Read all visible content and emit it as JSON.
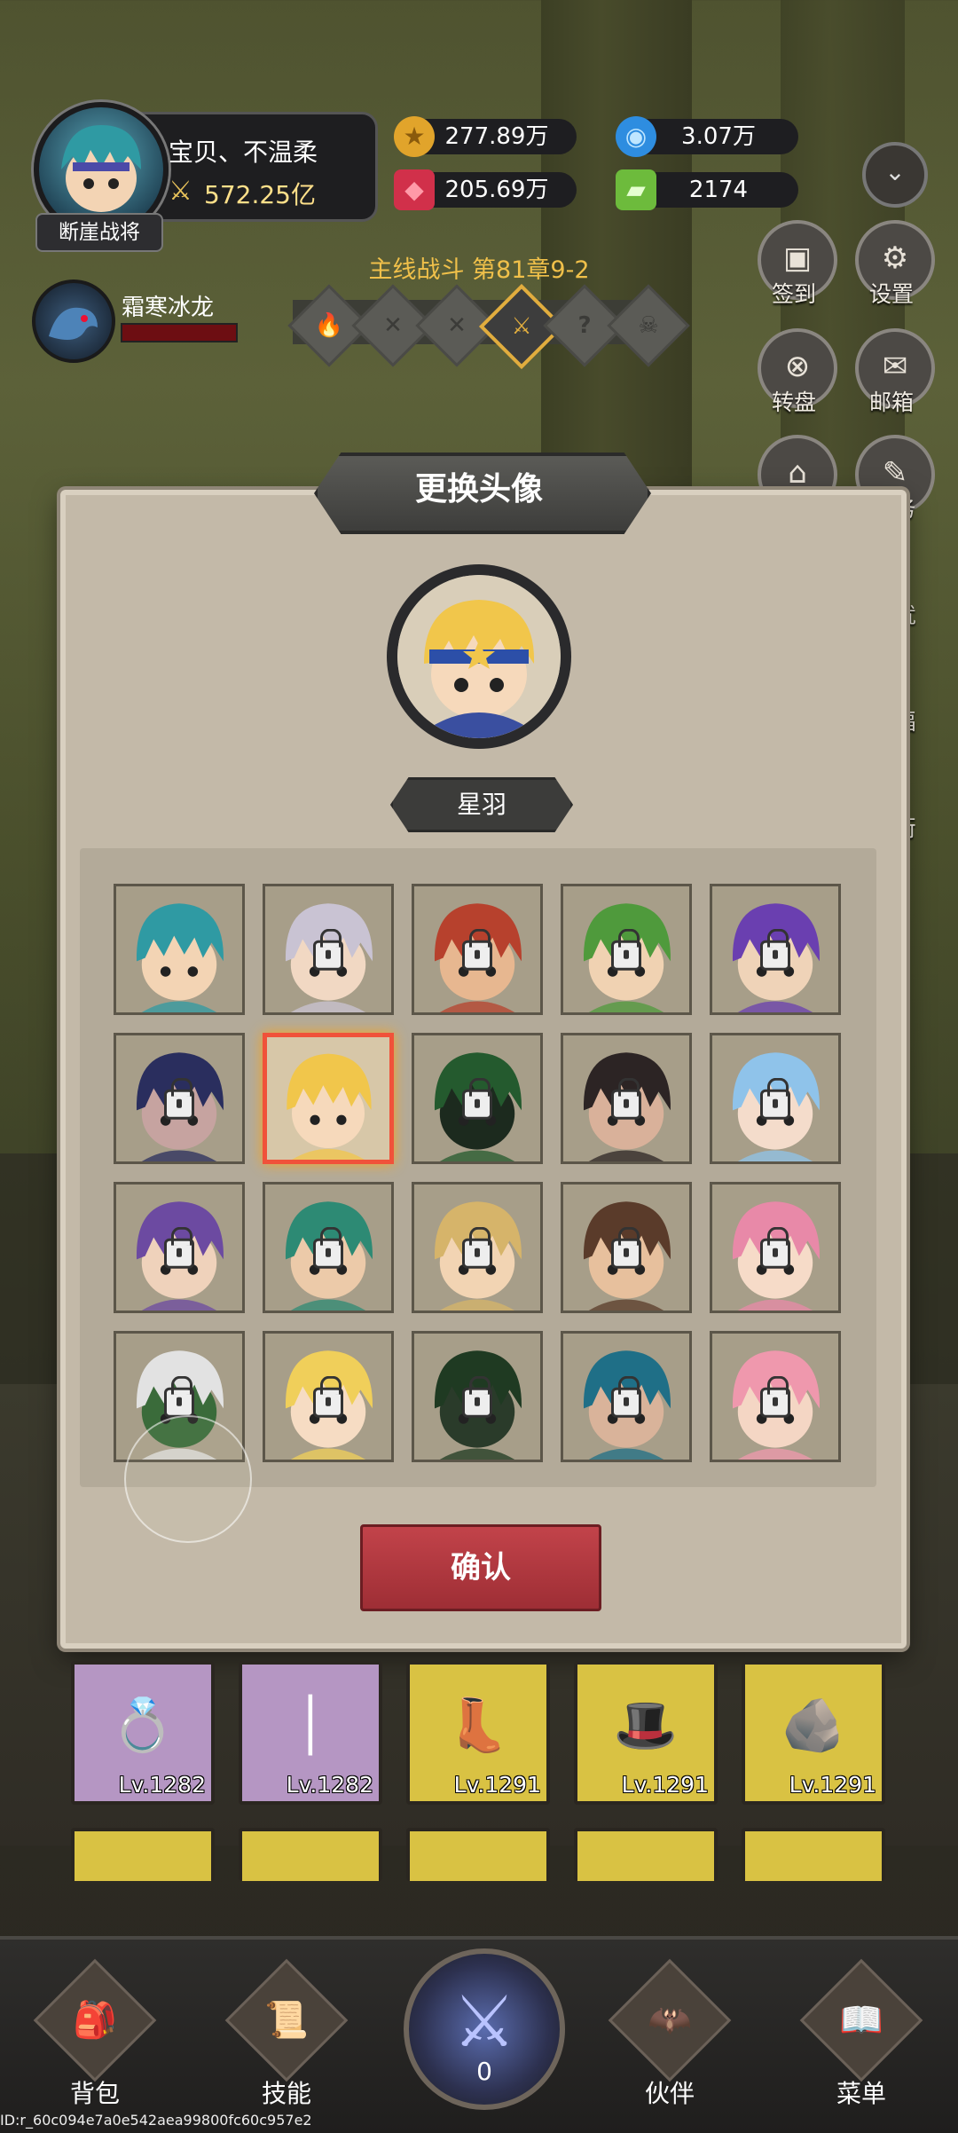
{
  "player": {
    "name": "宝贝、不温柔",
    "power": "572.25亿",
    "title": "断崖战将"
  },
  "resources": [
    {
      "icon": "gold-coin-icon",
      "value": "277.89万",
      "color": "#e1a42b"
    },
    {
      "icon": "blue-orb-icon",
      "value": "3.07万",
      "color": "#2e8de0"
    },
    {
      "icon": "red-gem-icon",
      "value": "205.69万",
      "color": "#d1304a"
    },
    {
      "icon": "green-ticket-icon",
      "value": "2174",
      "color": "#6dbb3c"
    }
  ],
  "companion": {
    "name": "霜寒冰龙"
  },
  "stage": {
    "label": "主线战斗 第81章9-2",
    "nodes": [
      "🔥",
      "✕",
      "✕",
      "⚔",
      "?",
      "☠"
    ]
  },
  "side_menu": {
    "checkin": "签到",
    "settings": "设置",
    "wheel": "转盘",
    "mail": "邮箱",
    "task": "务",
    "achievement": "就",
    "welfare": "福",
    "shop": "街"
  },
  "modal": {
    "title": "更换头像",
    "selected_name": "星羽",
    "confirm": "确认",
    "avatars": [
      {
        "hair": "#2f9aa3",
        "skin": "#f3d4b4",
        "locked": false
      },
      {
        "hair": "#c9c3d3",
        "skin": "#f1d8c3",
        "locked": true
      },
      {
        "hair": "#b7412d",
        "skin": "#e7b790",
        "locked": true
      },
      {
        "hair": "#4f9a3c",
        "skin": "#f0d2b2",
        "locked": true
      },
      {
        "hair": "#6a3fb0",
        "skin": "#efd3b8",
        "locked": true
      },
      {
        "hair": "#2a2e5e",
        "skin": "#c6a3a0",
        "locked": true
      },
      {
        "hair": "#f1c64b",
        "skin": "#f6d9bb",
        "locked": false,
        "selected": true
      },
      {
        "hair": "#245a2e",
        "skin": "#1c2a1e",
        "locked": true
      },
      {
        "hair": "#2c2424",
        "skin": "#d9b19a",
        "locked": true
      },
      {
        "hair": "#8fc3ea",
        "skin": "#f4dccb",
        "locked": true
      },
      {
        "hair": "#6c4aa1",
        "skin": "#efd2bb",
        "locked": true
      },
      {
        "hair": "#2d8a74",
        "skin": "#eccaa9",
        "locked": true
      },
      {
        "hair": "#d6b46a",
        "skin": "#f2d4b3",
        "locked": true
      },
      {
        "hair": "#5a3b2a",
        "skin": "#e7c09d",
        "locked": true
      },
      {
        "hair": "#e889a8",
        "skin": "#f6dbc8",
        "locked": true
      },
      {
        "hair": "#e2e2e2",
        "skin": "#3a6b3a",
        "locked": true
      },
      {
        "hair": "#f0cf5a",
        "skin": "#f6dcc3",
        "locked": true
      },
      {
        "hair": "#1f3a22",
        "skin": "#2a3b2a",
        "locked": true
      },
      {
        "hair": "#1f6f87",
        "skin": "#d9b39a",
        "locked": true
      },
      {
        "hair": "#ef98ad",
        "skin": "#f4d6c4",
        "locked": true
      }
    ]
  },
  "equipment": [
    {
      "level": "Lv.1282",
      "rarity": "purple",
      "icon": "ruby-ring-icon"
    },
    {
      "level": "Lv.1282",
      "rarity": "purple",
      "icon": "spear-icon"
    },
    {
      "level": "Lv.1291",
      "rarity": "gold",
      "icon": "boots-icon"
    },
    {
      "level": "Lv.1291",
      "rarity": "gold",
      "icon": "hat-icon"
    },
    {
      "level": "Lv.1291",
      "rarity": "gold",
      "icon": "rune-stone-icon"
    }
  ],
  "bottom_nav": {
    "bag": "背包",
    "skills": "技能",
    "battle_count": "0",
    "partner": "伙伴",
    "menu": "菜单"
  },
  "footer_id": "ID:r_60c094e7a0e542aea99800fc60c957e2"
}
